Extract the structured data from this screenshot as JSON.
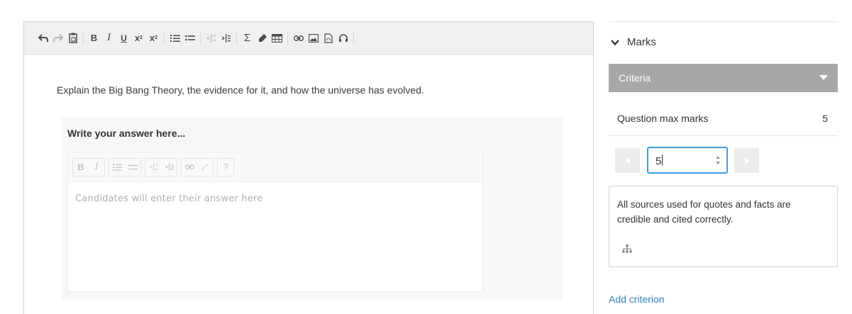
{
  "editor": {
    "question": "Explain the Big Bang Theory, the evidence for it, and how the universe has evolved.",
    "toolbar": {
      "groups": [
        [
          "undo-icon",
          "redo-icon",
          "paste-icon"
        ],
        [
          "bold-icon",
          "italic-icon",
          "underline-icon",
          "subscript-icon",
          "superscript-icon"
        ],
        [
          "ordered-list-icon",
          "unordered-list-icon"
        ],
        [
          "outdent-icon",
          "indent-icon"
        ],
        [
          "sigma-icon",
          "marker-icon",
          "table-icon"
        ],
        [
          "link-icon",
          "image-icon",
          "pdf-icon",
          "headphones-icon"
        ]
      ],
      "text_glyphs": {
        "bold": "B",
        "italic": "I",
        "underline": "U",
        "subscript": "x",
        "superscript": "x"
      }
    },
    "answer": {
      "label": "Write your answer here...",
      "placeholder": "Candidates will enter their answer here",
      "mini_toolbar_glyphs": {
        "bold": "B",
        "italic": "I",
        "help": "?"
      }
    }
  },
  "marks_panel": {
    "title": "Marks",
    "criteria_label": "Criteria",
    "max_marks_label": "Question max marks",
    "max_marks_value": "5",
    "mark_input_value": "5",
    "criterion_text": "All sources used for quotes and facts are credible and cited correctly.",
    "add_criterion_label": "Add criterion"
  },
  "colors": {
    "toolbar_bg": "#f0f0f0",
    "criteria_bar": "#a7a7a7",
    "input_focus": "#3f9fe0",
    "link": "#2f7fb8"
  }
}
